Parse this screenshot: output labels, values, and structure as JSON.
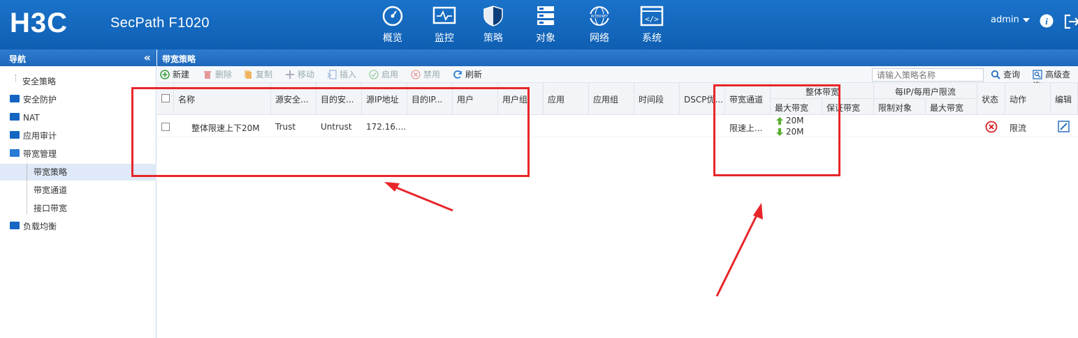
{
  "app": {
    "brand": "H3C",
    "product": "SecPath F1020"
  },
  "topnav": [
    {
      "label": "概览",
      "icon": "gauge-icon"
    },
    {
      "label": "监控",
      "icon": "monitor-icon"
    },
    {
      "label": "策略",
      "icon": "shield-icon"
    },
    {
      "label": "对象",
      "icon": "server-stack-icon"
    },
    {
      "label": "网络",
      "icon": "internet-globe-icon"
    },
    {
      "label": "系统",
      "icon": "code-window-icon"
    }
  ],
  "user": {
    "name": "admin"
  },
  "sidebar": {
    "title": "导航",
    "items": [
      {
        "label": "安全策略"
      },
      {
        "label": "安全防护"
      },
      {
        "label": "NAT"
      },
      {
        "label": "应用审计"
      },
      {
        "label": "带宽管理"
      },
      {
        "label": "带宽策略"
      },
      {
        "label": "带宽通道"
      },
      {
        "label": "接口带宽"
      },
      {
        "label": "负载均衡"
      }
    ]
  },
  "page": {
    "title": "带宽策略"
  },
  "toolbar": {
    "new": "新建",
    "delete": "删除",
    "copy": "复制",
    "move": "移动",
    "insert": "插入",
    "enable": "启用",
    "disable": "禁用",
    "refresh": "刷新",
    "search_placeholder": "请输入策略名称",
    "query": "查询",
    "advanced_query": "高级查询"
  },
  "table": {
    "headers": {
      "name": "名称",
      "src_zone": "源安全...",
      "dst_zone": "目的安...",
      "src_ip": "源IP地址",
      "dst_ip": "目的IP...",
      "user": "用户",
      "user_group": "用户组",
      "app": "应用",
      "app_group": "应用组",
      "time": "时间段",
      "dscp": "DSCP优...",
      "channel": "带宽通道",
      "overall_bw": "整体带宽",
      "max_bw": "最大带宽",
      "guaranteed_bw": "保证带宽",
      "per_ip_limit": "每IP/每用户限流",
      "limit_target": "限制对象",
      "per_max_bw": "最大带宽",
      "status": "状态",
      "action": "动作",
      "edit": "编辑"
    },
    "rows": [
      {
        "name": "整体限速上下20M",
        "src_zone": "Trust",
        "dst_zone": "Untrust",
        "src_ip": "172.16....",
        "channel": "限速上...",
        "max_up": "20M",
        "max_down": "20M",
        "status_icon": "disabled-x-icon",
        "action": "限流"
      }
    ]
  },
  "colors": {
    "brand_blue": "#1566c2",
    "annotation_red": "#e8262a"
  }
}
